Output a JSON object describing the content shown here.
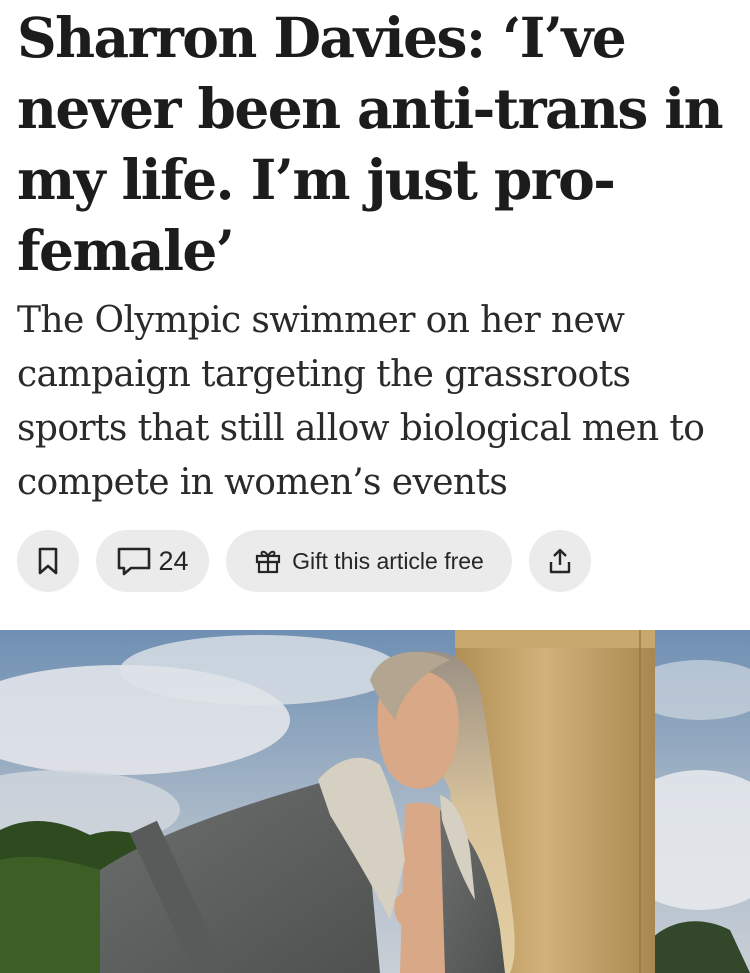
{
  "article": {
    "headline": "Sharron Davies: ‘I’ve never been anti-trans in my life. I’m just pro-female’",
    "standfirst": "The Olympic swimmer on her new campaign targeting the grassroots sports that still allow biological men to compete in women’s events"
  },
  "actions": {
    "bookmark_icon": "bookmark-icon",
    "comment_icon": "speech-bubble-icon",
    "comment_count": "24",
    "gift_icon": "gift-icon",
    "gift_label": "Gift this article free",
    "share_icon": "share-upload-icon"
  },
  "colors": {
    "text": "#1c1c1c",
    "pill_background": "#ebebeb",
    "page_background": "#ffffff"
  }
}
